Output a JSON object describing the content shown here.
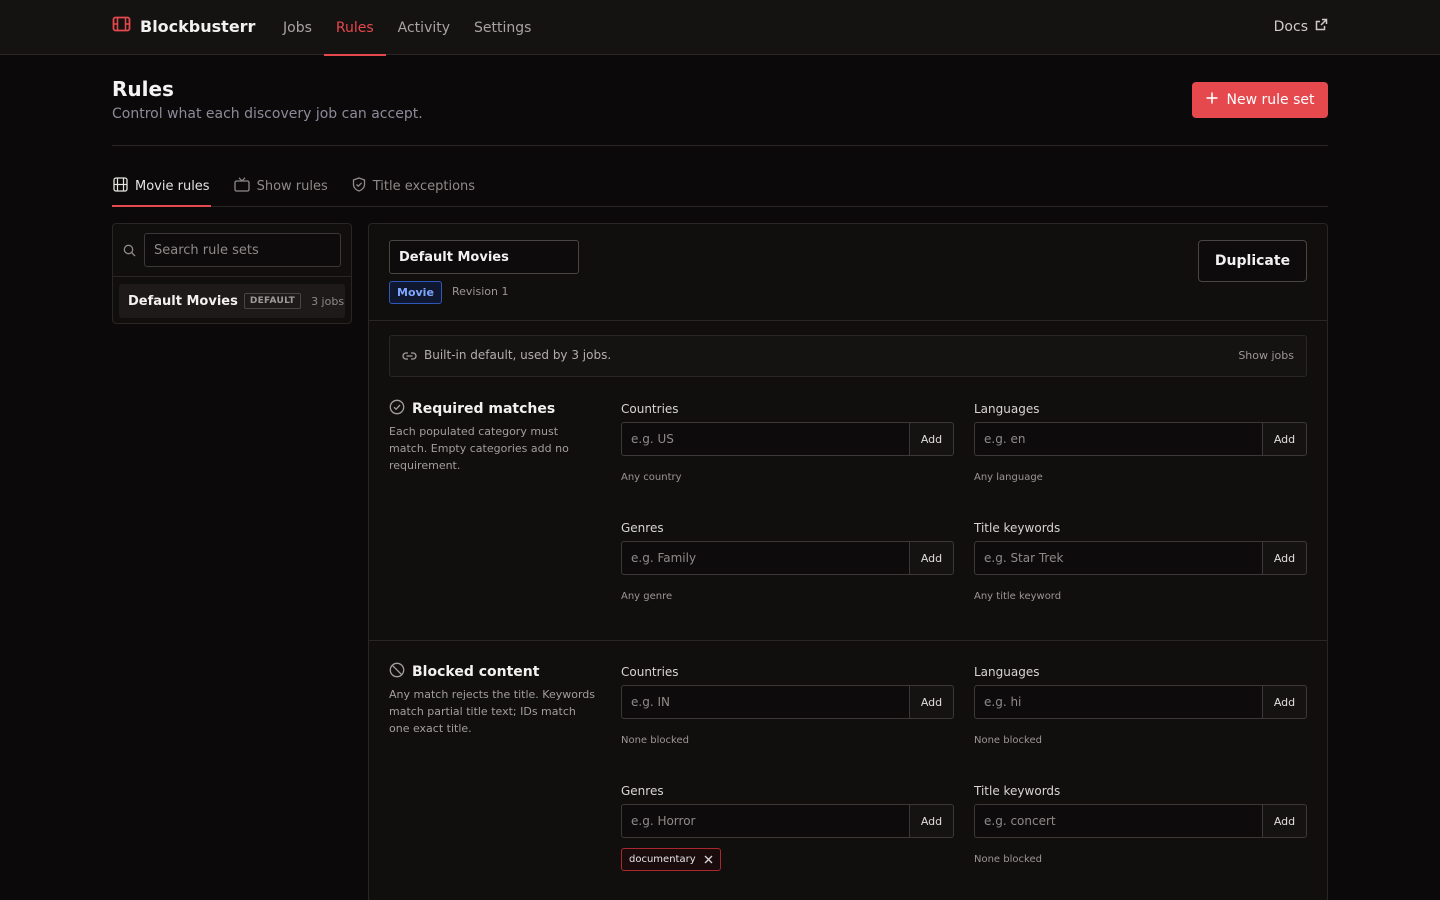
{
  "app": {
    "name": "Blockbusterr"
  },
  "nav": {
    "items": [
      {
        "label": "Jobs",
        "active": false
      },
      {
        "label": "Rules",
        "active": true
      },
      {
        "label": "Activity",
        "active": false
      },
      {
        "label": "Settings",
        "active": false
      }
    ],
    "docs_label": "Docs"
  },
  "header": {
    "title": "Rules",
    "subtitle": "Control what each discovery job can accept.",
    "new_button_label": "New rule set"
  },
  "tabs": [
    {
      "label": "Movie rules",
      "icon": "film-icon",
      "active": true
    },
    {
      "label": "Show rules",
      "icon": "tv-icon",
      "active": false
    },
    {
      "label": "Title exceptions",
      "icon": "shield-check-icon",
      "active": false
    }
  ],
  "sidebar": {
    "search_placeholder": "Search rule sets",
    "rulesets": [
      {
        "name": "Default Movies",
        "badge": "DEFAULT",
        "jobs": "3 jobs"
      }
    ]
  },
  "editor": {
    "name_value": "Default Movies",
    "type_tag": "Movie",
    "revision": "Revision 1",
    "duplicate_label": "Duplicate",
    "info_text": "Built-in default, used by 3 jobs.",
    "show_jobs_label": "Show jobs"
  },
  "required": {
    "title": "Required matches",
    "description": "Each populated category must match. Empty categories add no requirement.",
    "fields": {
      "countries": {
        "label": "Countries",
        "placeholder": "e.g. US",
        "add": "Add",
        "hint": "Any country"
      },
      "languages": {
        "label": "Languages",
        "placeholder": "e.g. en",
        "add": "Add",
        "hint": "Any language"
      },
      "genres": {
        "label": "Genres",
        "placeholder": "e.g. Family",
        "add": "Add",
        "hint": "Any genre"
      },
      "keywords": {
        "label": "Title keywords",
        "placeholder": "e.g. Star Trek",
        "add": "Add",
        "hint": "Any title keyword"
      }
    }
  },
  "blocked": {
    "title": "Blocked content",
    "description": "Any match rejects the title. Keywords match partial title text; IDs match one exact title.",
    "fields": {
      "countries": {
        "label": "Countries",
        "placeholder": "e.g. IN",
        "add": "Add",
        "hint": "None blocked"
      },
      "languages": {
        "label": "Languages",
        "placeholder": "e.g. hi",
        "add": "Add",
        "hint": "None blocked"
      },
      "genres": {
        "label": "Genres",
        "placeholder": "e.g. Horror",
        "add": "Add",
        "chips": [
          "documentary"
        ]
      },
      "keywords": {
        "label": "Title keywords",
        "placeholder": "e.g. concert",
        "add": "Add",
        "hint": "None blocked"
      }
    }
  },
  "colors": {
    "accent": "#e5484d",
    "background": "#0b0909",
    "panel": "#110e0e",
    "movie_tag": "#7ea6ff"
  }
}
